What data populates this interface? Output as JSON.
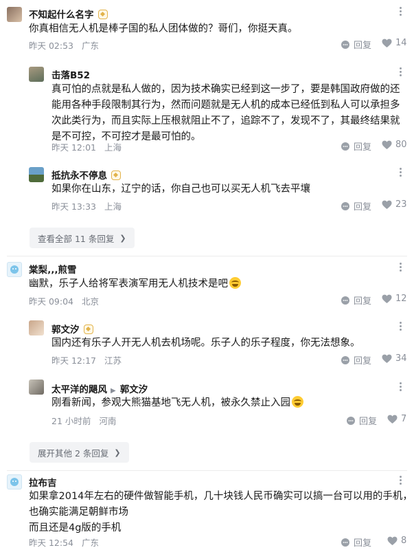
{
  "comments": [
    {
      "author": "不知起什么名字",
      "text": "你真相信无人机是棒子国的私人团体做的？哥们，你挺天真。",
      "time": "昨天 02:53",
      "location": "广东",
      "reply_label": "回复",
      "likes": "14",
      "replies": [
        {
          "author": "击落B52",
          "text": "真可怕的点就是私人做的，因为技术确实已经到这一步了，要是韩国政府做的还能用各种手段限制其行为，然而问题就是无人机的成本已经低到私人可以承担多次此类行为，而且实际上压根就阻止不了，追踪不了，发现不了，其最终结果就是不可控，不可控才是最可怕的。",
          "time": "昨天 12:01",
          "location": "上海",
          "reply_label": "回复",
          "likes": "80"
        },
        {
          "author": "抵抗永不停息",
          "text": "如果你在山东，辽宁的话，你自己也可以买无人机飞去平壤",
          "time": "昨天 13:33",
          "location": "上海",
          "reply_label": "回复",
          "likes": "23"
        }
      ],
      "expand_label": "查看全部 11 条回复"
    },
    {
      "author": "棠梨‚‚‚煎雪",
      "text": "幽默，乐子人给将军表演军用无人机技术是吧",
      "time": "昨天 09:04",
      "location": "北京",
      "reply_label": "回复",
      "likes": "12",
      "replies": [
        {
          "author": "郭文汐",
          "text": "国内还有乐子人开无人机去机场呢。乐子人的乐子程度，你无法想象。",
          "time": "昨天 12:17",
          "location": "江苏",
          "reply_label": "回复",
          "likes": "34"
        },
        {
          "author": "太平洋的飓风",
          "reply_to": "郭文汐",
          "text": "刚看新闻，参观大熊猫基地飞无人机，被永久禁止入园",
          "time": "21 小时前",
          "location": "河南",
          "reply_label": "回复",
          "likes": "7"
        }
      ],
      "expand_label": "展开其他 2 条回复"
    },
    {
      "author": "拉布吉",
      "text_lines": [
        "如果拿2014年左右的硬件做智能手机，几十块钱人民币确实可以搞一台可以用的手机，",
        "也确实能满足朝鲜市场",
        "而且还是4g版的手机"
      ],
      "time": "昨天 12:54",
      "location": "广东",
      "reply_label": "回复",
      "likes": "8"
    }
  ]
}
